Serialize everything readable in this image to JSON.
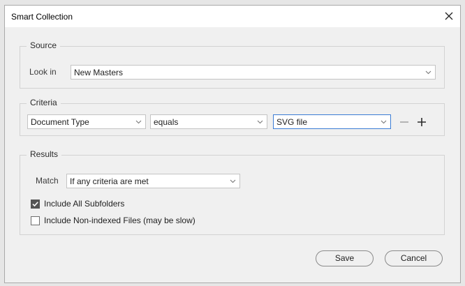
{
  "dialog": {
    "title": "Smart Collection"
  },
  "source": {
    "legend": "Source",
    "look_in_label": "Look in",
    "look_in_value": "New Masters"
  },
  "criteria": {
    "legend": "Criteria",
    "field": "Document Type",
    "operator": "equals",
    "value": "SVG file"
  },
  "results": {
    "legend": "Results",
    "match_label": "Match",
    "match_value": "If any criteria are met",
    "include_subfolders": {
      "label": "Include All Subfolders",
      "checked": true
    },
    "include_nonindexed": {
      "label": "Include Non-indexed Files (may be slow)",
      "checked": false
    }
  },
  "buttons": {
    "save": "Save",
    "cancel": "Cancel"
  },
  "icons": {
    "close": "close-icon",
    "dropdown": "chevron-down-icon",
    "remove": "minus-icon",
    "add": "plus-icon",
    "check": "checkmark-icon"
  },
  "colors": {
    "focus": "#3a7bd5",
    "checkbox": "#555555"
  }
}
